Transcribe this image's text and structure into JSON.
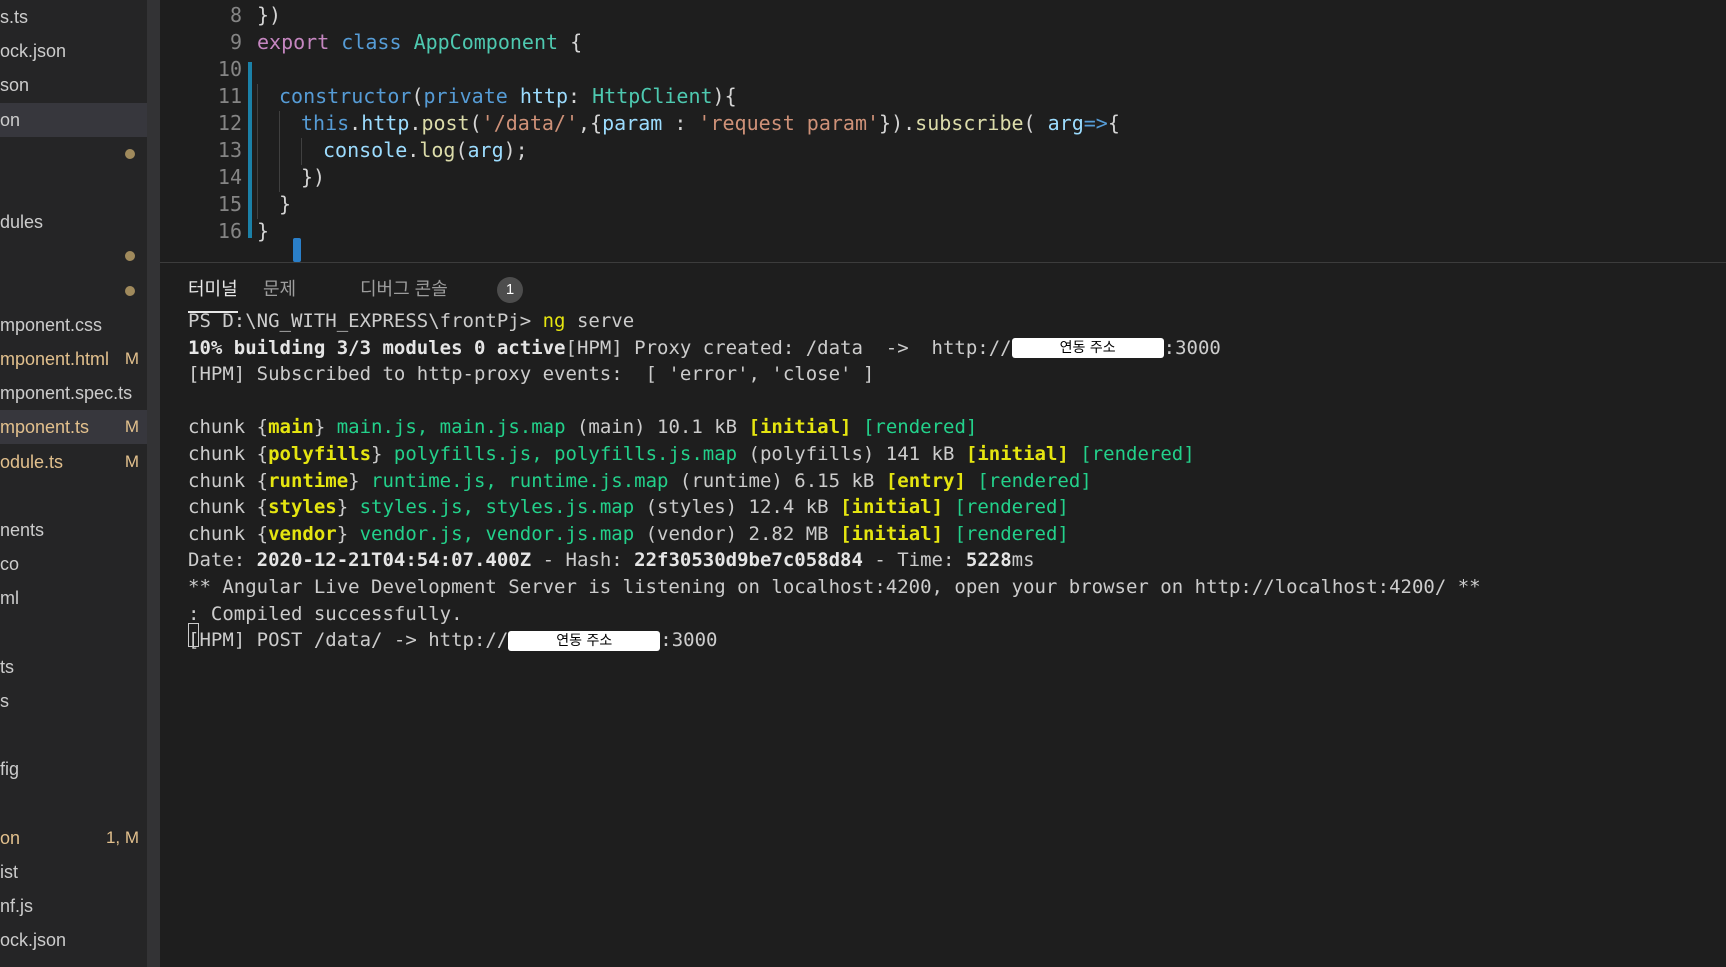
{
  "sidebar": {
    "items": [
      {
        "label": "s.ts",
        "badge": "",
        "style": "normal"
      },
      {
        "label": "ock.json",
        "badge": "",
        "style": "normal"
      },
      {
        "label": "son",
        "badge": "",
        "style": "normal"
      },
      {
        "label": "on",
        "badge": "",
        "style": "active"
      },
      {
        "label": "",
        "badge": "dot",
        "style": "normal"
      },
      {
        "label": "",
        "badge": "",
        "style": "normal"
      },
      {
        "label": "dules",
        "badge": "",
        "style": "normal"
      },
      {
        "label": "",
        "badge": "dot",
        "style": "normal"
      },
      {
        "label": "",
        "badge": "dot",
        "style": "normal"
      },
      {
        "label": "mponent.css",
        "badge": "",
        "style": "normal"
      },
      {
        "label": "mponent.html",
        "badge": "M",
        "style": "modified"
      },
      {
        "label": "mponent.spec.ts",
        "badge": "",
        "style": "normal"
      },
      {
        "label": "mponent.ts",
        "badge": "M",
        "style": "modified-active"
      },
      {
        "label": "odule.ts",
        "badge": "M",
        "style": "modified"
      },
      {
        "label": "",
        "badge": "",
        "style": "normal"
      },
      {
        "label": "nents",
        "badge": "",
        "style": "normal"
      },
      {
        "label": "co",
        "badge": "",
        "style": "normal"
      },
      {
        "label": "ml",
        "badge": "",
        "style": "normal"
      },
      {
        "label": "",
        "badge": "",
        "style": "normal"
      },
      {
        "label": "ts",
        "badge": "",
        "style": "normal"
      },
      {
        "label": "s",
        "badge": "",
        "style": "normal"
      },
      {
        "label": "",
        "badge": "",
        "style": "normal"
      },
      {
        "label": "fig",
        "badge": "",
        "style": "normal"
      },
      {
        "label": "",
        "badge": "",
        "style": "normal"
      },
      {
        "label": "on",
        "badge": "1, M",
        "style": "modified"
      },
      {
        "label": "ist",
        "badge": "",
        "style": "normal"
      },
      {
        "label": "nf.js",
        "badge": "",
        "style": "normal"
      },
      {
        "label": "ock.json",
        "badge": "",
        "style": "normal"
      }
    ]
  },
  "editor": {
    "lines": [
      {
        "num": "8",
        "indent": 0,
        "tokens": [
          [
            "punc",
            "})"
          ]
        ]
      },
      {
        "num": "9",
        "indent": 0,
        "tokens": [
          [
            "kw",
            "export"
          ],
          [
            "punc",
            " "
          ],
          [
            "kw2",
            "class"
          ],
          [
            "punc",
            " "
          ],
          [
            "cls",
            "AppComponent"
          ],
          [
            "punc",
            " {"
          ]
        ]
      },
      {
        "num": "10",
        "indent": 0,
        "tokens": []
      },
      {
        "num": "11",
        "indent": 1,
        "tokens": [
          [
            "kw2",
            "constructor"
          ],
          [
            "punc",
            "("
          ],
          [
            "kw2",
            "private"
          ],
          [
            "punc",
            " "
          ],
          [
            "var",
            "http"
          ],
          [
            "punc",
            ": "
          ],
          [
            "cls",
            "HttpClient"
          ],
          [
            "punc",
            "){"
          ]
        ]
      },
      {
        "num": "12",
        "indent": 2,
        "tokens": [
          [
            "kw2",
            "this"
          ],
          [
            "punc",
            "."
          ],
          [
            "var",
            "http"
          ],
          [
            "punc",
            "."
          ],
          [
            "fn",
            "post"
          ],
          [
            "punc",
            "("
          ],
          [
            "str",
            "'/data/'"
          ],
          [
            "punc",
            ",{"
          ],
          [
            "var",
            "param"
          ],
          [
            "punc",
            " : "
          ],
          [
            "str",
            "'request param'"
          ],
          [
            "punc",
            "})."
          ],
          [
            "fn",
            "subscribe"
          ],
          [
            "punc",
            "( "
          ],
          [
            "var",
            "arg"
          ],
          [
            "kw2",
            "=>"
          ],
          [
            "punc",
            "{"
          ]
        ]
      },
      {
        "num": "13",
        "indent": 3,
        "tokens": [
          [
            "var",
            "console"
          ],
          [
            "punc",
            "."
          ],
          [
            "fn",
            "log"
          ],
          [
            "punc",
            "("
          ],
          [
            "var",
            "arg"
          ],
          [
            "punc",
            ");"
          ]
        ]
      },
      {
        "num": "14",
        "indent": 2,
        "tokens": [
          [
            "punc",
            "})"
          ]
        ]
      },
      {
        "num": "15",
        "indent": 1,
        "tokens": [
          [
            "punc",
            "}"
          ]
        ]
      },
      {
        "num": "16",
        "indent": 0,
        "tokens": [
          [
            "punc",
            "}"
          ]
        ]
      }
    ]
  },
  "panel": {
    "tabs": [
      {
        "label": "터미널",
        "active": true
      },
      {
        "label": "문제",
        "active": false
      },
      {
        "label": "디버그 콘솔",
        "active": false
      }
    ],
    "problems_count": "1"
  },
  "terminal": {
    "redaction_label": "연동 주소",
    "lines": [
      [
        [
          "n",
          "PS D:\\NG_WITH_EXPRESS\\frontPj> "
        ],
        [
          "y",
          "ng"
        ],
        [
          "n",
          " serve"
        ]
      ],
      [
        [
          "b",
          "10% building 3/3 modules 0 active"
        ],
        [
          "n",
          "[HPM] Proxy created: /data  ->  http://"
        ],
        [
          "redact",
          ""
        ],
        [
          "n",
          ":3000"
        ]
      ],
      [
        [
          "n",
          "[HPM] Subscribed to http-proxy events:  [ 'error', 'close' ]"
        ]
      ],
      [],
      [
        [
          "n",
          "chunk {"
        ],
        [
          "yb",
          "main"
        ],
        [
          "n",
          "} "
        ],
        [
          "g",
          "main.js, main.js.map"
        ],
        [
          "n",
          " (main) 10.1 kB "
        ],
        [
          "yb",
          "[initial]"
        ],
        [
          "n",
          " "
        ],
        [
          "g",
          "[rendered]"
        ]
      ],
      [
        [
          "n",
          "chunk {"
        ],
        [
          "yb",
          "polyfills"
        ],
        [
          "n",
          "} "
        ],
        [
          "g",
          "polyfills.js, polyfills.js.map"
        ],
        [
          "n",
          " (polyfills) 141 kB "
        ],
        [
          "yb",
          "[initial]"
        ],
        [
          "n",
          " "
        ],
        [
          "g",
          "[rendered]"
        ]
      ],
      [
        [
          "n",
          "chunk {"
        ],
        [
          "yb",
          "runtime"
        ],
        [
          "n",
          "} "
        ],
        [
          "g",
          "runtime.js, runtime.js.map"
        ],
        [
          "n",
          " (runtime) 6.15 kB "
        ],
        [
          "yb",
          "[entry]"
        ],
        [
          "n",
          " "
        ],
        [
          "g",
          "[rendered]"
        ]
      ],
      [
        [
          "n",
          "chunk {"
        ],
        [
          "yb",
          "styles"
        ],
        [
          "n",
          "} "
        ],
        [
          "g",
          "styles.js, styles.js.map"
        ],
        [
          "n",
          " (styles) 12.4 kB "
        ],
        [
          "yb",
          "[initial]"
        ],
        [
          "n",
          " "
        ],
        [
          "g",
          "[rendered]"
        ]
      ],
      [
        [
          "n",
          "chunk {"
        ],
        [
          "yb",
          "vendor"
        ],
        [
          "n",
          "} "
        ],
        [
          "g",
          "vendor.js, vendor.js.map"
        ],
        [
          "n",
          " (vendor) 2.82 MB "
        ],
        [
          "yb",
          "[initial]"
        ],
        [
          "n",
          " "
        ],
        [
          "g",
          "[rendered]"
        ]
      ],
      [
        [
          "n",
          "Date: "
        ],
        [
          "b",
          "2020-12-21T04:54:07.400Z"
        ],
        [
          "n",
          " - Hash: "
        ],
        [
          "b",
          "22f30530d9be7c058d84"
        ],
        [
          "n",
          " - Time: "
        ],
        [
          "b",
          "5228"
        ],
        [
          "n",
          "ms"
        ]
      ],
      [
        [
          "n",
          "** Angular Live Development Server is listening on localhost:4200, open your browser on http://localhost:4200/ **"
        ]
      ],
      [
        [
          "n",
          ": Compiled successfully."
        ]
      ],
      [
        [
          "n",
          "[HPM] POST /data/ -> http://"
        ],
        [
          "redact",
          ""
        ],
        [
          "n",
          ":3000"
        ]
      ]
    ]
  }
}
